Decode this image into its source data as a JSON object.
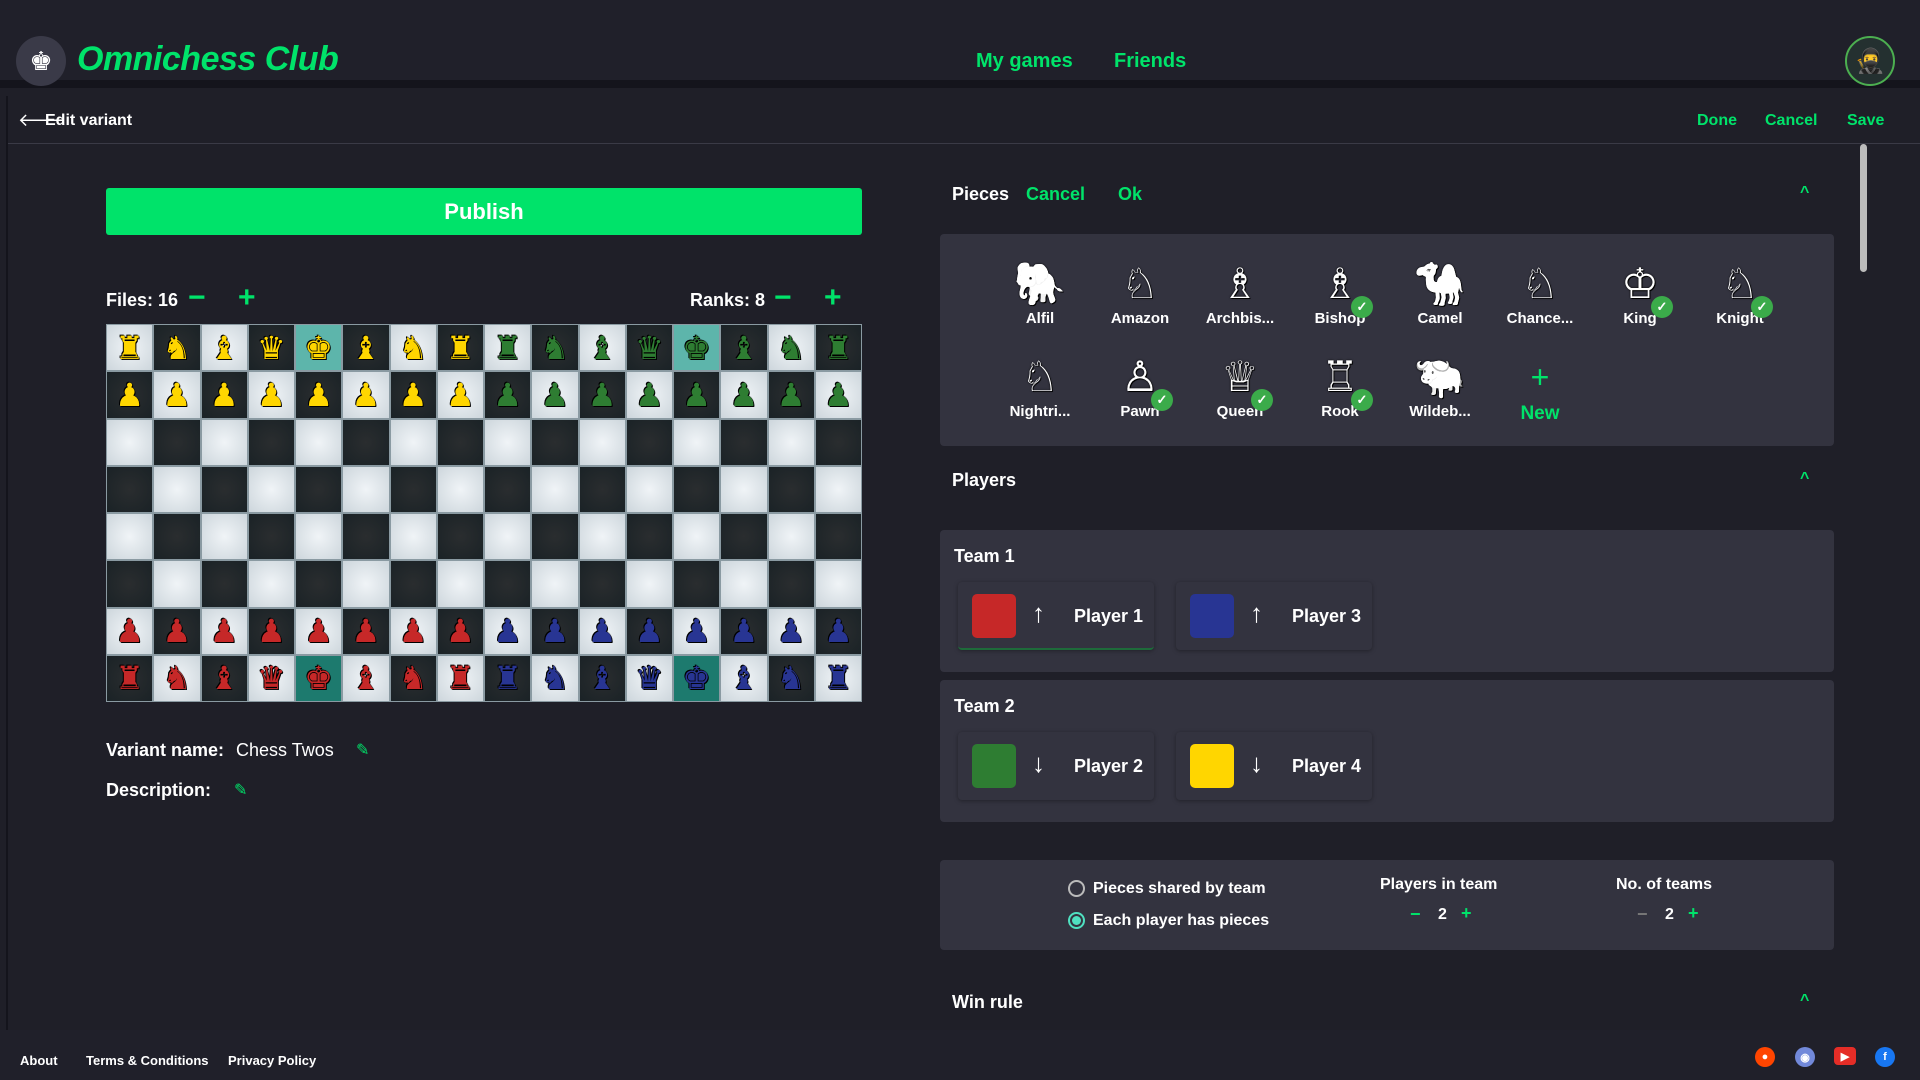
{
  "header": {
    "brand": "Omnichess Club",
    "nav": [
      {
        "label": "My games"
      },
      {
        "label": "Friends"
      }
    ]
  },
  "toolbar": {
    "title": "Edit variant",
    "done": "Done",
    "cancel": "Cancel",
    "save": "Save"
  },
  "editor": {
    "publish": "Publish",
    "files_label": "Files: 16",
    "ranks_label": "Ranks: 8",
    "files": 16,
    "ranks": 8,
    "variant_name_label": "Variant name:",
    "variant_name": "Chess Twos",
    "description_label": "Description:"
  },
  "board": {
    "colors": {
      "yellow": "#ffd600",
      "green": "#2e7d32",
      "red": "#c62828",
      "blue": "#283593"
    },
    "rows": [
      [
        "yR",
        "yN",
        "yB",
        "yQ",
        "yK",
        "yB",
        "yN",
        "yR",
        "gR",
        "gN",
        "gB",
        "gQ",
        "gK",
        "gB",
        "gN",
        "gR"
      ],
      [
        "yP",
        "yP",
        "yP",
        "yP",
        "yP",
        "yP",
        "yP",
        "yP",
        "gP",
        "gP",
        "gP",
        "gP",
        "gP",
        "gP",
        "gP",
        "gP"
      ],
      [
        "",
        "",
        "",
        "",
        "",
        "",
        "",
        "",
        "",
        "",
        "",
        "",
        "",
        "",
        "",
        ""
      ],
      [
        "",
        "",
        "",
        "",
        "",
        "",
        "",
        "",
        "",
        "",
        "",
        "",
        "",
        "",
        "",
        ""
      ],
      [
        "",
        "",
        "",
        "",
        "",
        "",
        "",
        "",
        "",
        "",
        "",
        "",
        "",
        "",
        "",
        ""
      ],
      [
        "",
        "",
        "",
        "",
        "",
        "",
        "",
        "",
        "",
        "",
        "",
        "",
        "",
        "",
        "",
        ""
      ],
      [
        "rP",
        "rP",
        "rP",
        "rP",
        "rP",
        "rP",
        "rP",
        "rP",
        "bP",
        "bP",
        "bP",
        "bP",
        "bP",
        "bP",
        "bP",
        "bP"
      ],
      [
        "rR",
        "rN",
        "rB",
        "rQ",
        "rK",
        "rB",
        "rN",
        "rR",
        "bR",
        "bN",
        "bB",
        "bQ",
        "bK",
        "bB",
        "bN",
        "bR"
      ]
    ]
  },
  "pieces_section": {
    "title": "Pieces",
    "cancel": "Cancel",
    "ok": "Ok",
    "new_label": "New",
    "items": [
      {
        "name": "Alfil",
        "icon": "elephant",
        "selected": false
      },
      {
        "name": "Amazon",
        "icon": "amazon",
        "selected": false
      },
      {
        "name": "Archbis...",
        "icon": "archbishop",
        "selected": false
      },
      {
        "name": "Bishop",
        "icon": "bishop",
        "selected": true
      },
      {
        "name": "Camel",
        "icon": "camel",
        "selected": false
      },
      {
        "name": "Chance...",
        "icon": "chancellor",
        "selected": false
      },
      {
        "name": "King",
        "icon": "king",
        "selected": true
      },
      {
        "name": "Knight",
        "icon": "knight",
        "selected": true
      },
      {
        "name": "Nightri...",
        "icon": "nightrider",
        "selected": false
      },
      {
        "name": "Pawn",
        "icon": "pawn",
        "selected": true
      },
      {
        "name": "Queen",
        "icon": "queen",
        "selected": true
      },
      {
        "name": "Rook",
        "icon": "rook",
        "selected": true
      },
      {
        "name": "Wildeb...",
        "icon": "wildebeest",
        "selected": false
      }
    ]
  },
  "players_section": {
    "title": "Players",
    "teams": [
      {
        "label": "Team 1",
        "players": [
          {
            "name": "Player 1",
            "color": "#c62828",
            "direction": "up"
          },
          {
            "name": "Player 3",
            "color": "#283593",
            "direction": "up"
          }
        ]
      },
      {
        "label": "Team 2",
        "players": [
          {
            "name": "Player 2",
            "color": "#2e7d32",
            "direction": "down"
          },
          {
            "name": "Player 4",
            "color": "#ffd600",
            "direction": "down"
          }
        ]
      }
    ],
    "options": {
      "shared": "Pieces shared by team",
      "each": "Each player has pieces",
      "selected": "each"
    },
    "players_in_team_label": "Players in team",
    "players_in_team": "2",
    "num_teams_label": "No. of teams",
    "num_teams": "2"
  },
  "win_rule": {
    "title": "Win rule"
  },
  "footer": {
    "links": [
      {
        "label": "About"
      },
      {
        "label": "Terms & Conditions"
      },
      {
        "label": "Privacy Policy"
      }
    ],
    "social": [
      "reddit",
      "discord",
      "youtube",
      "facebook"
    ]
  }
}
